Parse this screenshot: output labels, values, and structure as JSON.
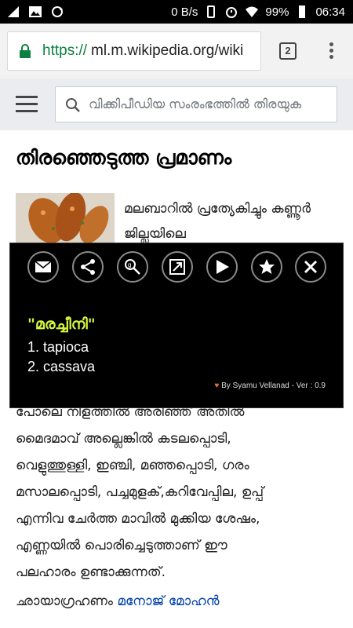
{
  "status_bar": {
    "network_speed": "0 B/s",
    "battery": "99%",
    "time": "06:34"
  },
  "browser": {
    "url_scheme": "https://",
    "url_host": "ml.m.wikipedia.org/wiki",
    "tab_count": "2"
  },
  "wiki": {
    "search_placeholder": "വിക്കിപീഡിയ സംരംഭത്തിൽ തിരയുക",
    "page_title": "തിരഞ്ഞെടുത്ത പ്രമാണം",
    "lead_text": "മലബാറിൽ പ്രത്യേകിച്ചും കണ്ണൂർ ജില്ലയിലെ",
    "body_text_lines": [
      "പോലെ നീളത്തിൽ അരിഞ്ഞ് അതിൽ",
      "മൈദമാവ് അല്ലെങ്കിൽ കടലപ്പൊടി,",
      "വെളുത്തുള്ളി, ഇഞ്ചി, മഞ്ഞപ്പൊടി, ഗരം",
      "മസാലപ്പൊടി, പച്ചമുളക്,കറിവേപ്പില, ഉപ്പ്",
      "എന്നിവ ചേർത്ത മാവിൽ മുക്കിയ ശേഷം,",
      "എണ്ണയിൽ പൊരിച്ചെടുത്താണ് ഈ",
      "പലഹാരം ഉണ്ടാക്കുന്നത്."
    ],
    "credit_label": "ഛായാഗ്രഹണം",
    "credit_link": "മനോജ് മോഹൻ"
  },
  "popup": {
    "word": "\"മരച്ചീനി\"",
    "definitions": [
      "1.  tapioca",
      "2.  cassava"
    ],
    "footer": "By Syamu Vellanad - Ver : 0.9",
    "tools": [
      "mail-icon",
      "share-icon",
      "google-search-icon",
      "expand-icon",
      "play-store-icon",
      "star-icon",
      "close-icon"
    ]
  }
}
